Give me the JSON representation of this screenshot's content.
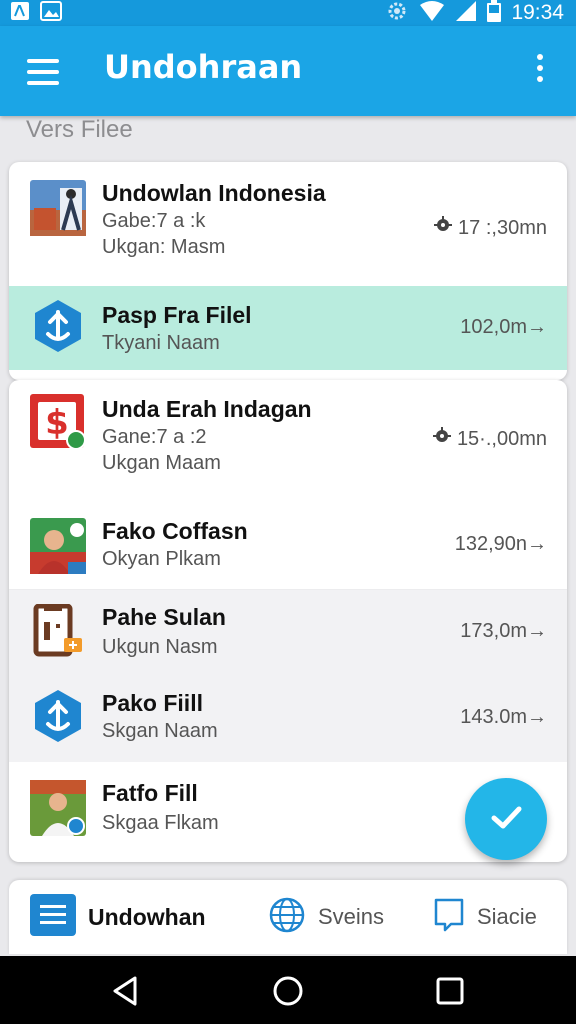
{
  "status_bar": {
    "time": "19:34"
  },
  "app_bar": {
    "title": "Undohraan"
  },
  "section": {
    "header": "Vers Filee"
  },
  "files": [
    {
      "title": "Undowlan Indonesia",
      "subtitle_1": "Gabe:7 a :k",
      "subtitle_2": "Ukgan: Masm",
      "meta": "17 :,30mn",
      "icon": "photo-thumbnail-icon"
    },
    {
      "title": "Pasp Fra Filel",
      "subtitle_1": "Tkyani Naam",
      "meta": "102,0m→",
      "icon": "hexagon-app-icon"
    },
    {
      "title": "Unda Erah Indagan",
      "subtitle_1": "Gane:7 a :2",
      "subtitle_2": "Ukgan Maam",
      "meta": "15·.,00mn",
      "icon": "dollar-app-icon"
    },
    {
      "title": "Fako Coffasn",
      "subtitle_1": "Okyan Plkam",
      "meta": "132,90n→",
      "icon": "person-thumbnail-icon"
    },
    {
      "title": "Pahe Sulan",
      "subtitle_1": "Ukgun Nasm",
      "meta": "173,0m→",
      "icon": "document-icon"
    },
    {
      "title": "Pako Fiill",
      "subtitle_1": "Skgan Naam",
      "meta": "143.0m→",
      "icon": "hexagon-app-icon"
    },
    {
      "title": "Fatfo Fill",
      "subtitle_1": "Skgaa Flkam",
      "icon": "person-thumbnail-icon"
    }
  ],
  "bottom_nav": {
    "items": [
      {
        "label": "Undowhan",
        "icon": "list-icon",
        "active": true
      },
      {
        "label": "Sveins",
        "icon": "globe-icon",
        "active": false
      },
      {
        "label": "Siacie",
        "icon": "chat-bubble-icon",
        "active": false
      }
    ]
  },
  "colors": {
    "primary": "#1ba5e6",
    "status_bar": "#1599dc",
    "highlight": "#b9ecde",
    "fab": "#23b6e8",
    "app_icon_blue": "#1f86d0"
  }
}
